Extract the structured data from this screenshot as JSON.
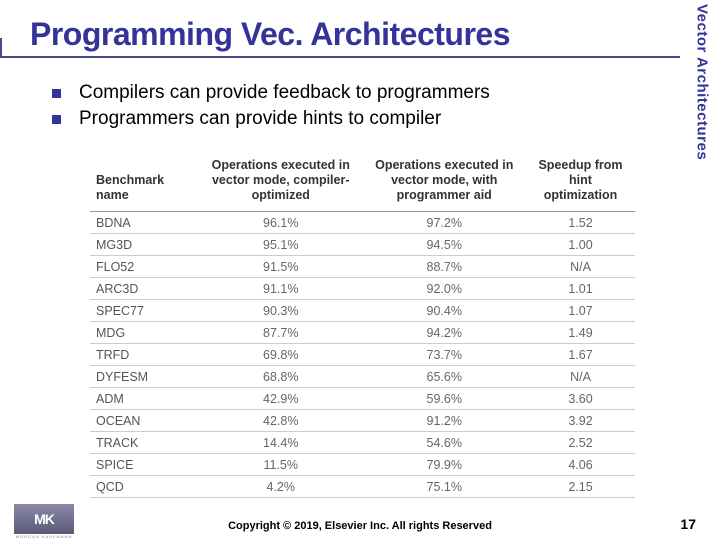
{
  "title": "Programming Vec. Architectures",
  "side_label": "Vector Architectures",
  "bullets": [
    "Compilers can provide feedback to programmers",
    "Programmers can provide hints to compiler"
  ],
  "table": {
    "headers": [
      "Benchmark name",
      "Operations executed in vector mode, compiler-optimized",
      "Operations executed in vector mode, with programmer aid",
      "Speedup from hint optimization"
    ],
    "rows": [
      [
        "BDNA",
        "96.1%",
        "97.2%",
        "1.52"
      ],
      [
        "MG3D",
        "95.1%",
        "94.5%",
        "1.00"
      ],
      [
        "FLO52",
        "91.5%",
        "88.7%",
        "N/A"
      ],
      [
        "ARC3D",
        "91.1%",
        "92.0%",
        "1.01"
      ],
      [
        "SPEC77",
        "90.3%",
        "90.4%",
        "1.07"
      ],
      [
        "MDG",
        "87.7%",
        "94.2%",
        "1.49"
      ],
      [
        "TRFD",
        "69.8%",
        "73.7%",
        "1.67"
      ],
      [
        "DYFESM",
        "68.8%",
        "65.6%",
        "N/A"
      ],
      [
        "ADM",
        "42.9%",
        "59.6%",
        "3.60"
      ],
      [
        "OCEAN",
        "42.8%",
        "91.2%",
        "3.92"
      ],
      [
        "TRACK",
        "14.4%",
        "54.6%",
        "2.52"
      ],
      [
        "SPICE",
        "11.5%",
        "79.9%",
        "4.06"
      ],
      [
        "QCD",
        "4.2%",
        "75.1%",
        "2.15"
      ]
    ]
  },
  "footer": "Copyright © 2019, Elsevier Inc. All rights Reserved",
  "page_number": "17",
  "logo": {
    "main": "MK",
    "sub": "MORGAN KAUFMANN"
  }
}
